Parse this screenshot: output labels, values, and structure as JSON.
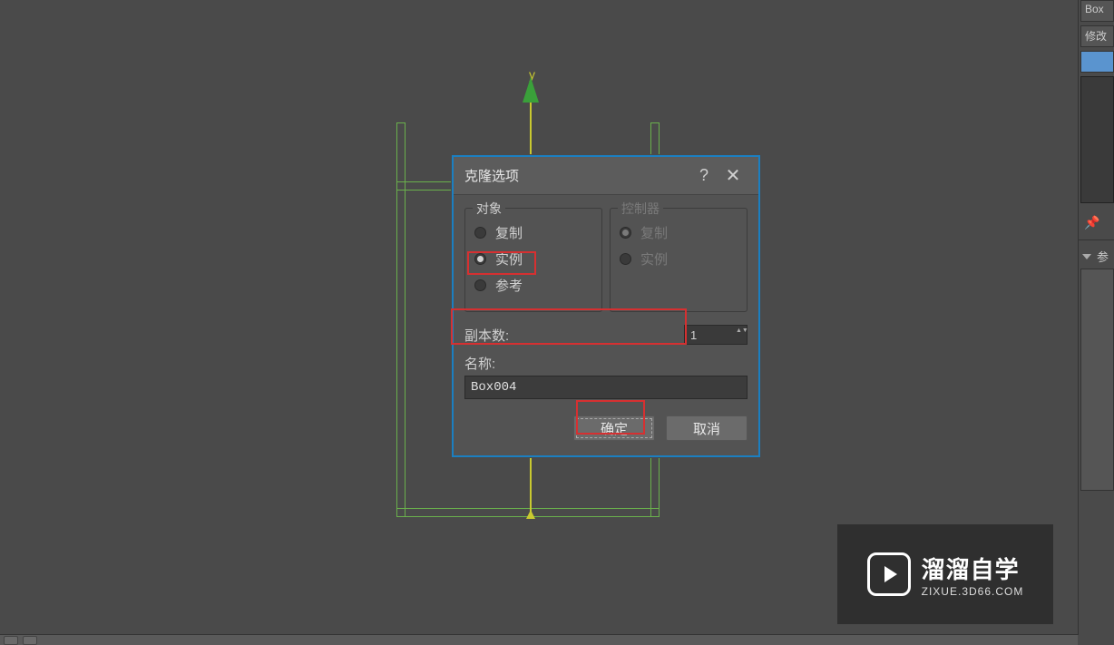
{
  "viewport": {
    "axis_y_label": "y"
  },
  "right_panel": {
    "item1": "Box",
    "item2": "修改",
    "rollout_label": "参",
    "pin_icon": "pin-icon"
  },
  "dialog": {
    "title": "克隆选项",
    "help_tooltip": "?",
    "close_tooltip": "×",
    "object_group": {
      "legend": "对象",
      "copy": "复制",
      "instance": "实例",
      "reference": "参考",
      "selected": "instance"
    },
    "controller_group": {
      "legend": "控制器",
      "copy": "复制",
      "instance": "实例",
      "selected": "copy",
      "disabled": true
    },
    "copies_label": "副本数:",
    "copies_value": "1",
    "name_label": "名称:",
    "name_value": "Box004",
    "ok": "确定",
    "cancel": "取消"
  },
  "watermark": {
    "line1": "溜溜自学",
    "line2": "ZIXUE.3D66.COM"
  }
}
